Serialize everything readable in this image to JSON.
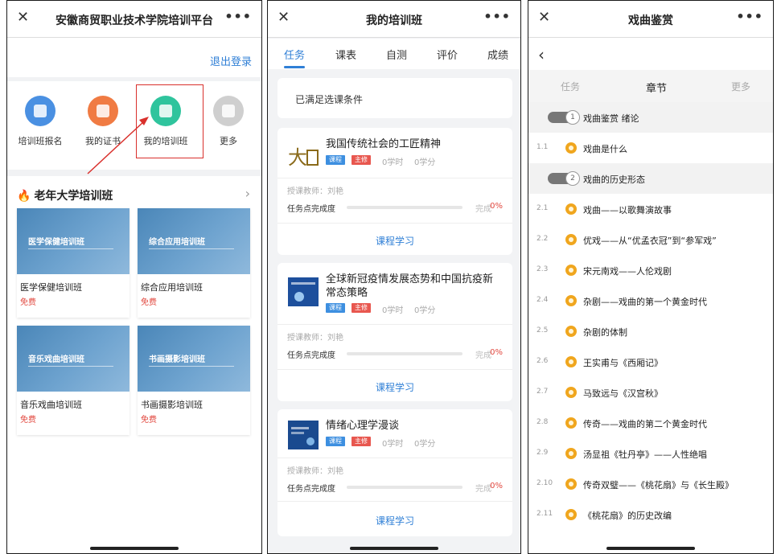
{
  "panel1": {
    "title": "安徽商贸职业技术学院培训平台",
    "logout": "退出登录",
    "icons": [
      {
        "label": "培训班报名",
        "color": "#4a90e2",
        "icon": "signup-icon"
      },
      {
        "label": "我的证书",
        "color": "#f07b43",
        "icon": "certificate-icon"
      },
      {
        "label": "我的培训班",
        "color": "#2fc49d",
        "icon": "my-class-icon"
      },
      {
        "label": "更多",
        "color": "#cfcfcf",
        "icon": "more-grid-icon"
      }
    ],
    "section_title": "老年大学培训班",
    "cards": [
      {
        "caption": "医学保健培训班",
        "name": "医学保健培训班",
        "price": "免费"
      },
      {
        "caption": "综合应用培训班",
        "name": "综合应用培训班",
        "price": "免费"
      },
      {
        "caption": "音乐戏曲培训班",
        "name": "音乐戏曲培训班",
        "price": "免费"
      },
      {
        "caption": "书画摄影培训班",
        "name": "书画摄影培训班",
        "price": "免费"
      }
    ]
  },
  "panel2": {
    "title": "我的培训班",
    "tabs": [
      "任务",
      "课表",
      "自测",
      "评价",
      "成绩"
    ],
    "notice": "已满足选课条件",
    "tag_course": "课程",
    "tag_required": "主修",
    "courses": [
      {
        "title": "我国传统社会的工匠精神",
        "hours": "0学时",
        "credits": "0学分",
        "teacher": "授课教师：刘艳",
        "progress_label": "任务点完成度",
        "done": "完成",
        "pct": "0%",
        "action": "课程学习"
      },
      {
        "title": "全球新冠疫情发展态势和中国抗疫新常态策略",
        "hours": "0学时",
        "credits": "0学分",
        "teacher": "授课教师：刘艳",
        "progress_label": "任务点完成度",
        "done": "完成",
        "pct": "0%",
        "action": "课程学习"
      },
      {
        "title": "情绪心理学漫谈",
        "hours": "0学时",
        "credits": "0学分",
        "teacher": "授课教师：刘艳",
        "progress_label": "任务点完成度",
        "done": "完成",
        "pct": "0%",
        "action": "课程学习"
      }
    ]
  },
  "panel3": {
    "title": "戏曲鉴赏",
    "tabs": [
      "任务",
      "章节",
      "更多"
    ],
    "chapters": [
      {
        "type": "header",
        "num": "1",
        "title": "戏曲鉴赏 绪论"
      },
      {
        "type": "item",
        "num": "1.1",
        "title": "戏曲是什么"
      },
      {
        "type": "header",
        "num": "2",
        "title": "戏曲的历史形态"
      },
      {
        "type": "item",
        "num": "2.1",
        "title": "戏曲——以歌舞演故事"
      },
      {
        "type": "item",
        "num": "2.2",
        "title": "优戏——从“优孟衣冠”到“参军戏”"
      },
      {
        "type": "item",
        "num": "2.3",
        "title": "宋元南戏——人伦戏剧"
      },
      {
        "type": "item",
        "num": "2.4",
        "title": "杂剧——戏曲的第一个黄金时代"
      },
      {
        "type": "item",
        "num": "2.5",
        "title": "杂剧的体制"
      },
      {
        "type": "item",
        "num": "2.6",
        "title": "王实甫与《西厢记》"
      },
      {
        "type": "item",
        "num": "2.7",
        "title": "马致远与《汉宫秋》"
      },
      {
        "type": "item",
        "num": "2.8",
        "title": "传奇——戏曲的第二个黄金时代"
      },
      {
        "type": "item",
        "num": "2.9",
        "title": "汤显祖《牡丹亭》——人性绝唱"
      },
      {
        "type": "item",
        "num": "2.10",
        "title": "传奇双璧——《桃花扇》与《长生殿》"
      },
      {
        "type": "item",
        "num": "2.11",
        "title": "《桃花扇》的历史改编"
      }
    ]
  }
}
